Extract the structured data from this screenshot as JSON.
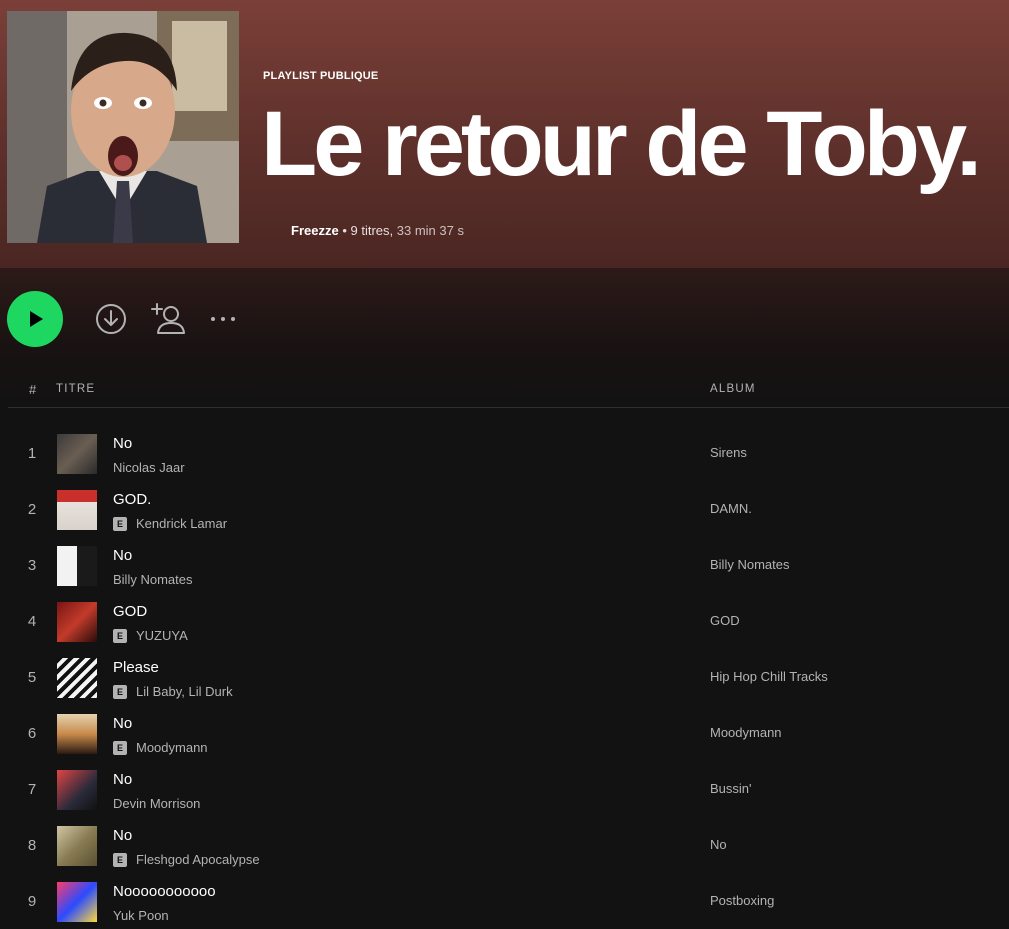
{
  "playlist": {
    "type_label": "PLAYLIST PUBLIQUE",
    "title": "Le retour de Toby.",
    "owner": "Freezze",
    "separator": "•",
    "track_count": "9 titres,",
    "duration": "33 min 37 s"
  },
  "actions": {
    "play_icon": "play-icon",
    "download_icon": "download-icon",
    "add_user_icon": "add-user-icon",
    "more_icon": "more-options-icon",
    "accent_color": "#1ed760"
  },
  "table": {
    "headers": {
      "number": "#",
      "title": "TITRE",
      "album": "ALBUM"
    },
    "explicit_badge": "E",
    "rows": [
      {
        "num": "1",
        "title": "No",
        "artist": "Nicolas Jaar",
        "album": "Sirens",
        "explicit": false
      },
      {
        "num": "2",
        "title": "GOD.",
        "artist": "Kendrick Lamar",
        "album": "DAMN.",
        "explicit": true
      },
      {
        "num": "3",
        "title": "No",
        "artist": "Billy Nomates",
        "album": "Billy Nomates",
        "explicit": false
      },
      {
        "num": "4",
        "title": "GOD",
        "artist": "YUZUYA",
        "album": "GOD",
        "explicit": true
      },
      {
        "num": "5",
        "title": "Please",
        "artist": "Lil Baby, Lil Durk",
        "album": "Hip Hop Chill Tracks",
        "explicit": true
      },
      {
        "num": "6",
        "title": "No",
        "artist": "Moodymann",
        "album": "Moodymann",
        "explicit": true
      },
      {
        "num": "7",
        "title": "No",
        "artist": "Devin Morrison",
        "album": "Bussin'",
        "explicit": false
      },
      {
        "num": "8",
        "title": "No",
        "artist": "Fleshgod Apocalypse",
        "album": "No",
        "explicit": true
      },
      {
        "num": "9",
        "title": "Nooooooooooo",
        "artist": "Yuk Poon",
        "album": "Postboxing",
        "explicit": false
      }
    ]
  }
}
